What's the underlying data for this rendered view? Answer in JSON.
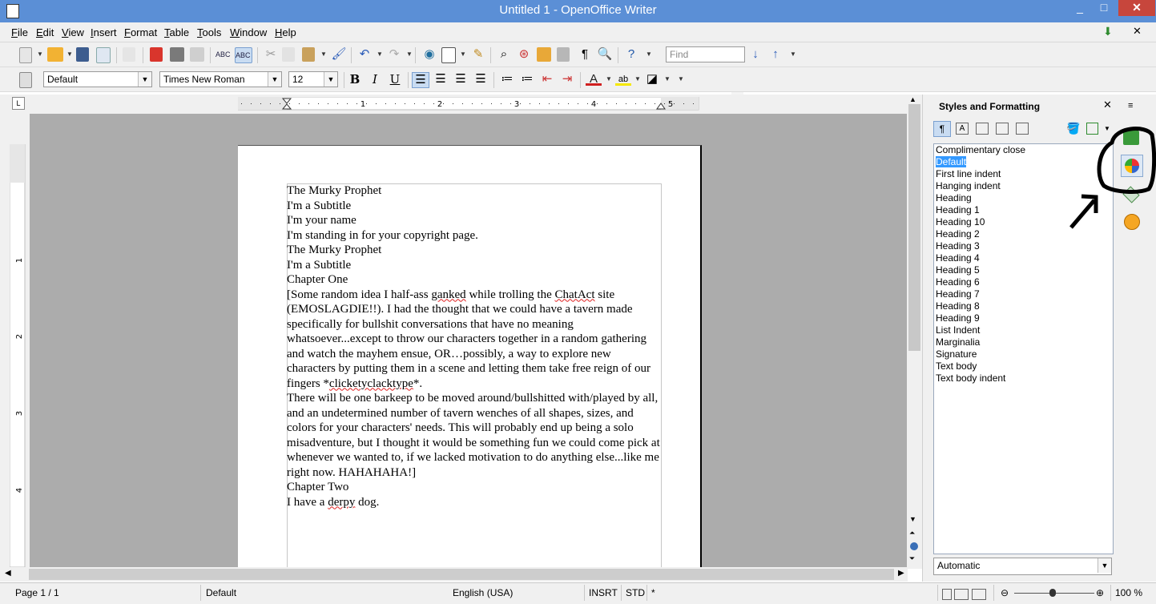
{
  "window": {
    "title": "Untitled 1 - OpenOffice Writer",
    "minimize": "_",
    "maximize": "□",
    "close": "✕"
  },
  "menu": [
    "File",
    "Edit",
    "View",
    "Insert",
    "Format",
    "Table",
    "Tools",
    "Window",
    "Help"
  ],
  "toolbar": {
    "find_placeholder": "Find",
    "paragraph_style": "Default",
    "font_name": "Times New Roman",
    "font_size": "12"
  },
  "ruler": {
    "h_ticks": [
      "1",
      "2",
      "3",
      "4",
      "5"
    ],
    "v_ticks": [
      "1",
      "2",
      "3",
      "4"
    ]
  },
  "document": {
    "paragraphs": [
      "The Murky Prophet",
      "I'm a Subtitle",
      "I'm your name",
      "I'm standing in for your copyright page.",
      "The Murky Prophet",
      "I'm a Subtitle",
      "Chapter One"
    ],
    "p1_a": "[Some random idea I half-ass ",
    "p1_b": "ganked",
    "p1_c": " while trolling the ",
    "p1_d": "ChatAct",
    "p1_e": " site (EMOSLAGDIE!!). I had the thought that we could have a tavern made specifically for bullshit conversations that have no meaning whatsoever...except to throw our characters together in a random gathering and watch the mayhem ensue, OR…possibly, a way to explore new characters by putting them in a scene and letting them take free reign of our fingers *",
    "p1_f": "clicketyclacktype",
    "p1_g": "*.",
    "p2": "There will be one barkeep to be moved around/bullshitted with/played by all, and an undetermined number of tavern wenches of all shapes, sizes, and colors for your characters' needs. This will probably end up being a solo misadventure, but I thought it would be something fun we could come pick at whenever we wanted to, if we lacked motivation to do anything else...like me right now. HAHAHAHA!]",
    "p3": "Chapter Two",
    "p4_a": "I have a ",
    "p4_b": "derpy",
    "p4_c": " dog."
  },
  "sidebar": {
    "title": "Styles and Formatting",
    "styles": [
      "Complimentary close",
      "Default",
      "First line indent",
      "Hanging indent",
      "Heading",
      "Heading 1",
      "Heading 10",
      "Heading 2",
      "Heading 3",
      "Heading 4",
      "Heading 5",
      "Heading 6",
      "Heading 7",
      "Heading 8",
      "Heading 9",
      "List Indent",
      "Marginalia",
      "Signature",
      "Text body",
      "Text body indent"
    ],
    "selected_style": "Default",
    "filter": "Automatic"
  },
  "status": {
    "page": "Page 1 / 1",
    "style": "Default",
    "language": "English (USA)",
    "insert_mode": "INSRT",
    "selection_mode": "STD",
    "modified": "*",
    "zoom": "100 %"
  }
}
